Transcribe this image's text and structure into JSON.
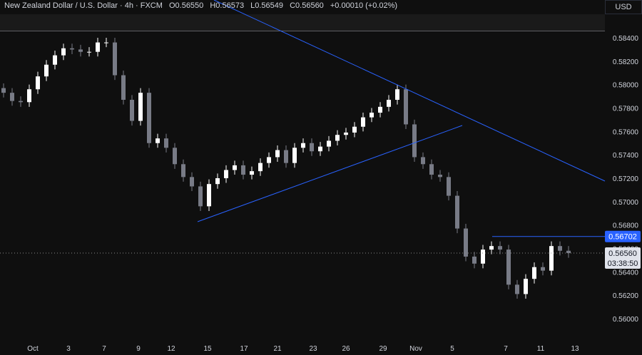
{
  "header": {
    "symbol": "New Zealand Dollar / U.S. Dollar · 4h · FXCM",
    "open": "O0.56550",
    "high": "H0.56573",
    "low": "L0.56549",
    "close": "C0.56560",
    "change": "+0.00010 (+0.02%)",
    "currency": "USD"
  },
  "chart_data": {
    "type": "candlestick",
    "title": "New Zealand Dollar / U.S. Dollar · 4h · FXCM",
    "ylim": [
      0.5595,
      0.586
    ],
    "yticks": [
      "0.58400",
      "0.58200",
      "0.58000",
      "0.57800",
      "0.57600",
      "0.57400",
      "0.57200",
      "0.57000",
      "0.56800",
      "0.56600",
      "0.56400",
      "0.56200",
      "0.56000"
    ],
    "xticks": [
      "Oct",
      "3",
      "7",
      "9",
      "12",
      "15",
      "17",
      "21",
      "23",
      "26",
      "29",
      "Nov",
      "5",
      "7",
      "11",
      "13"
    ],
    "closes": [
      0.5793,
      0.5786,
      0.5785,
      0.5796,
      0.5807,
      0.5817,
      0.5825,
      0.5831,
      0.583,
      0.5828,
      0.5828,
      0.5836,
      0.5836,
      0.5808,
      0.5787,
      0.5769,
      0.5793,
      0.575,
      0.5754,
      0.5746,
      0.5732,
      0.5721,
      0.5713,
      0.5696,
      0.5715,
      0.572,
      0.5727,
      0.5731,
      0.5723,
      0.5726,
      0.5733,
      0.5738,
      0.5744,
      0.5733,
      0.5746,
      0.575,
      0.5743,
      0.5747,
      0.5752,
      0.5757,
      0.5759,
      0.5764,
      0.5772,
      0.5776,
      0.5781,
      0.5787,
      0.5796,
      0.5766,
      0.5738,
      0.5732,
      0.5723,
      0.5721,
      0.5705,
      0.5677,
      0.5653,
      0.5647,
      0.5659,
      0.5662,
      0.5659,
      0.5629,
      0.5621,
      0.5634,
      0.5644,
      0.5641,
      0.5662,
      0.5658,
      0.5656
    ],
    "levels": {
      "resistance": "0.56702",
      "last_price": "0.56560",
      "countdown": "03:38:50",
      "top_level": 0.5846
    },
    "colors": {
      "up": "#ffffff",
      "down": "#787b86",
      "trendline": "#2962ff",
      "level_label": "#2962ff"
    }
  }
}
